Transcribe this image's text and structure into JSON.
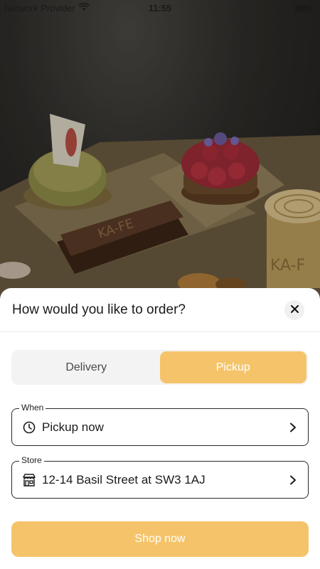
{
  "status_bar": {
    "carrier": "Network Provider",
    "time": "11:55"
  },
  "sheet": {
    "title": "How would you like to order?",
    "tabs": [
      {
        "label": "Delivery",
        "active": false
      },
      {
        "label": "Pickup",
        "active": true
      }
    ],
    "when": {
      "legend": "When",
      "value": "Pickup now",
      "icon": "clock-icon"
    },
    "store": {
      "legend": "Store",
      "value": "12-14 Basil Street at SW3 1AJ",
      "icon": "storefront-icon"
    },
    "shop_button": "Shop now"
  },
  "colors": {
    "accent": "#f5c46a",
    "segment_bg": "#f3f3f3",
    "text": "#1b1b1b"
  }
}
